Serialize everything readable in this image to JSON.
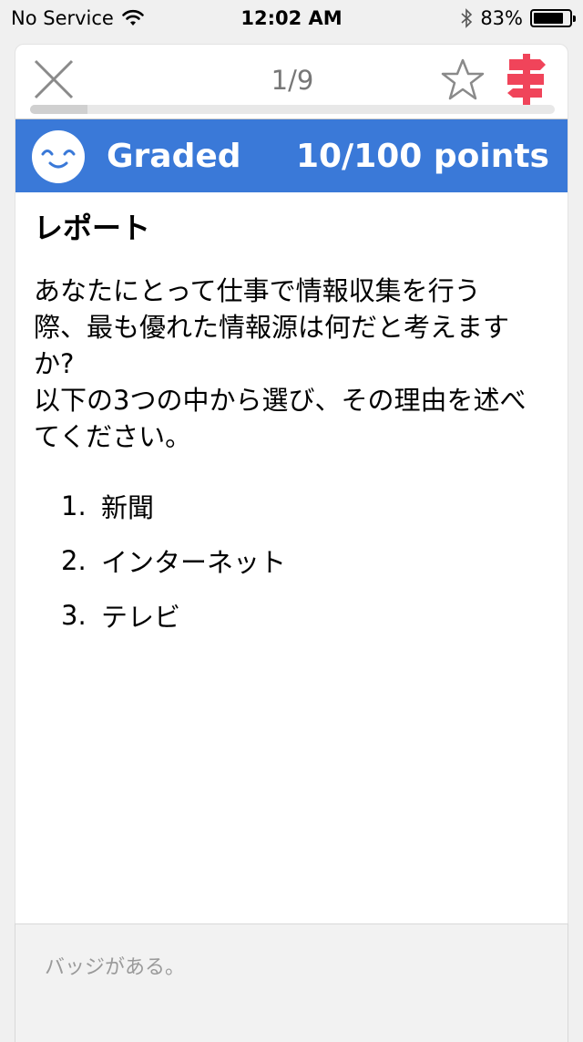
{
  "status_bar": {
    "carrier": "No Service",
    "time": "12:02 AM",
    "battery_percent": "83%",
    "battery_level": 0.83,
    "icons": [
      "wifi-icon",
      "bluetooth-icon",
      "battery-icon"
    ]
  },
  "nav": {
    "page_counter": "1/9",
    "progress_fraction": 0.11,
    "icons": [
      "close-icon",
      "star-icon",
      "signpost-icon"
    ],
    "accent_color": "#f0445a"
  },
  "banner": {
    "status": "Graded",
    "score": "10/100 points",
    "color": "#3a79d8",
    "icon": "smiley-face-icon"
  },
  "question": {
    "title": "レポート",
    "lines": [
      "あなたにとって仕事で情報収集を行う",
      "際、最も優れた情報源は何だと考えます",
      "か?",
      "以下の3つの中から選び、その理由を述べ",
      "てください。"
    ],
    "options": [
      {
        "num": "1.",
        "label": "新聞"
      },
      {
        "num": "2.",
        "label": "インターネット"
      },
      {
        "num": "3.",
        "label": "テレビ"
      }
    ]
  },
  "answer_input": {
    "placeholder": "バッジがある。",
    "value": ""
  }
}
